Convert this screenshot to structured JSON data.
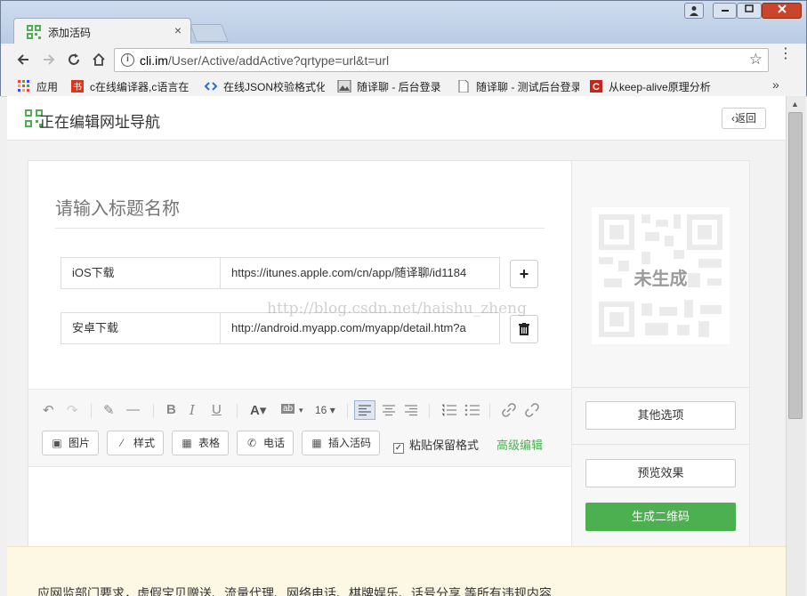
{
  "browser": {
    "tab_title": "添加活码",
    "tab_close": "×",
    "url_domain": "cli.im",
    "url_path": "/User/Active/addActive?qrtype=url&t=url",
    "bookmarks": [
      {
        "label": "应用"
      },
      {
        "label": "c在线编译器,c语言在"
      },
      {
        "label": "在线JSON校验格式化"
      },
      {
        "label": "随译聊 - 后台登录"
      },
      {
        "label": "随译聊 - 测试后台登录"
      },
      {
        "label": "从keep-alive原理分析"
      }
    ],
    "bookmarks_more": "»"
  },
  "header": {
    "page_title": "正在编辑网址导航",
    "back_label": "返回"
  },
  "editor": {
    "title_placeholder": "请输入标题名称",
    "rows": [
      {
        "label": "iOS下载",
        "url": "https://itunes.apple.com/cn/app/随译聊/id1184"
      },
      {
        "label": "安卓下载",
        "url": "http://android.myapp.com/myapp/detail.htm?a"
      }
    ],
    "add_button": "+",
    "watermark": "http://blog.csdn.net/haishu_zheng",
    "font_size": "16",
    "buttons": {
      "image": "图片",
      "style": "样式",
      "table": "表格",
      "phone": "电话",
      "insert_code": "插入活码"
    },
    "keep_format": "粘贴保留格式",
    "advanced": "高级编辑"
  },
  "sidebar": {
    "qr_status": "未生成",
    "other_options": "其他选项",
    "preview": "预览效果",
    "generate": "生成二维码"
  },
  "notice": {
    "text": "应网监部门要求，虚假宝贝赠送、流量代理、网络电话、棋牌娱乐、话号分享 等所有违规内容"
  },
  "colors": {
    "accent_green": "#4caf50",
    "close_red": "#c9462d"
  }
}
